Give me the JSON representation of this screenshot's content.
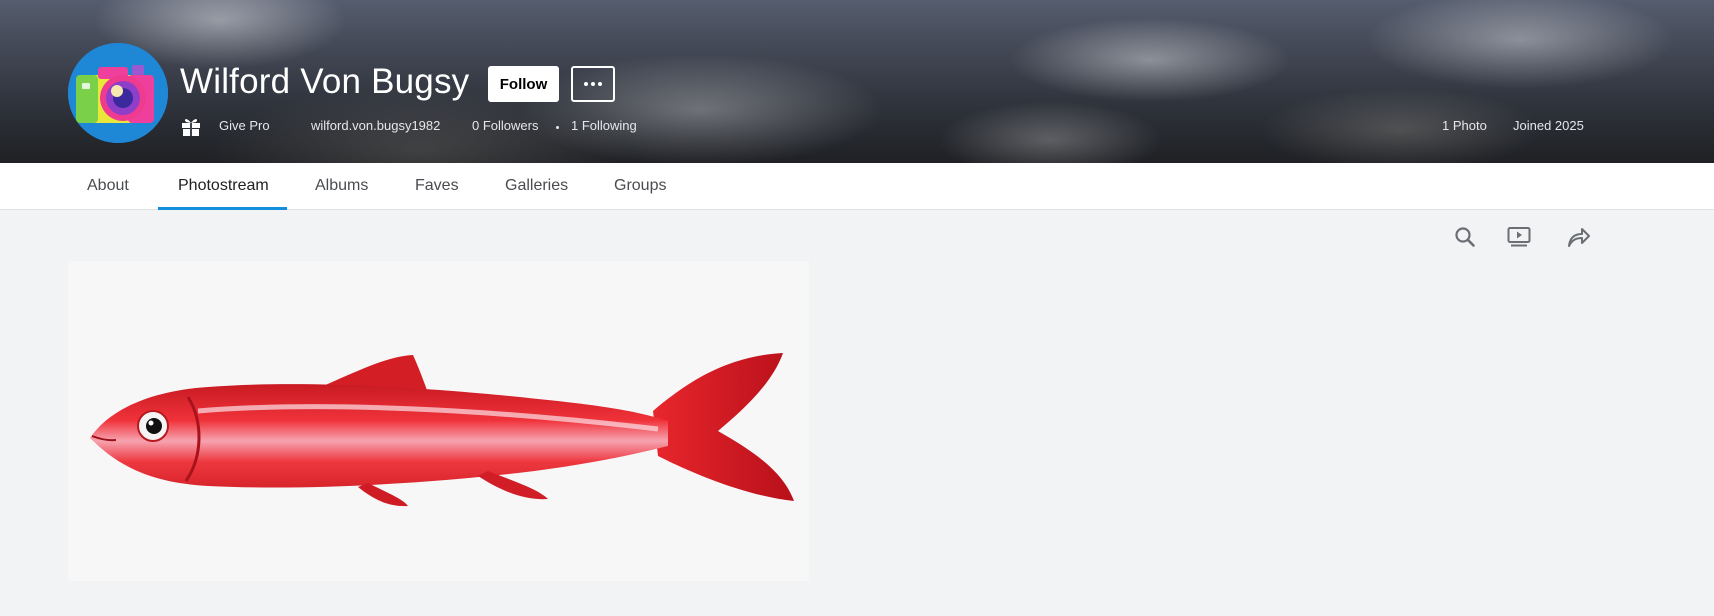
{
  "profile": {
    "name": "Wilford Von Bugsy",
    "follow_label": "Follow",
    "give_pro_label": "Give Pro",
    "username": "wilford.von.bugsy1982",
    "followers": "0 Followers",
    "following": "1 Following",
    "photo_count": "1 Photo",
    "joined": "Joined 2025"
  },
  "tabs": [
    {
      "label": "About",
      "active": false
    },
    {
      "label": "Photostream",
      "active": true
    },
    {
      "label": "Albums",
      "active": false
    },
    {
      "label": "Faves",
      "active": false
    },
    {
      "label": "Galleries",
      "active": false
    },
    {
      "label": "Groups",
      "active": false
    }
  ],
  "toolbar": {
    "icons": [
      "search-icon",
      "slideshow-icon",
      "share-icon"
    ]
  },
  "colors": {
    "accent": "#128fdc",
    "avatar_bg": "#1e88d6",
    "fish": "#e8262c"
  }
}
